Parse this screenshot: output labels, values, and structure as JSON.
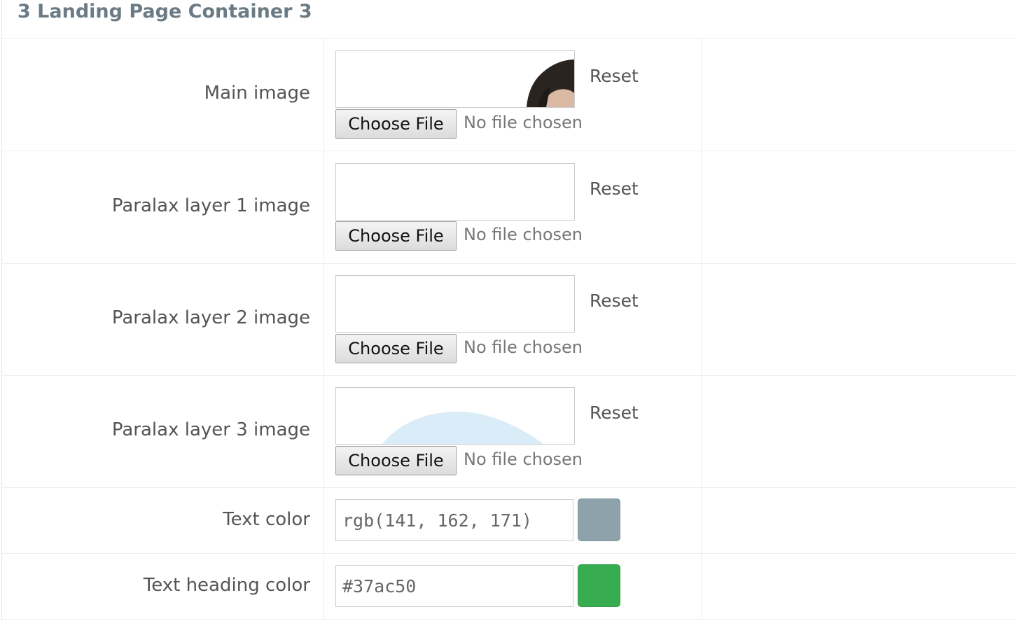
{
  "section": {
    "title": "3 Landing Page Container 3"
  },
  "image_fields": [
    {
      "label": "Main image",
      "reset_label": "Reset",
      "choose_label": "Choose File",
      "status": "No file chosen",
      "preview_icon": "person-hair-thumbnail"
    },
    {
      "label": "Paralax layer 1 image",
      "reset_label": "Reset",
      "choose_label": "Choose File",
      "status": "No file chosen",
      "preview_icon": "blank-thumbnail"
    },
    {
      "label": "Paralax layer 2 image",
      "reset_label": "Reset",
      "choose_label": "Choose File",
      "status": "No file chosen",
      "preview_icon": "blank-thumbnail"
    },
    {
      "label": "Paralax layer 3 image",
      "reset_label": "Reset",
      "choose_label": "Choose File",
      "status": "No file chosen",
      "preview_icon": "light-blue-arc-thumbnail"
    }
  ],
  "color_fields": [
    {
      "label": "Text color",
      "value": "rgb(141, 162, 171)",
      "swatch": "#8da2ab"
    },
    {
      "label": "Text heading color",
      "value": "#37ac50",
      "swatch": "#37ac50"
    }
  ]
}
